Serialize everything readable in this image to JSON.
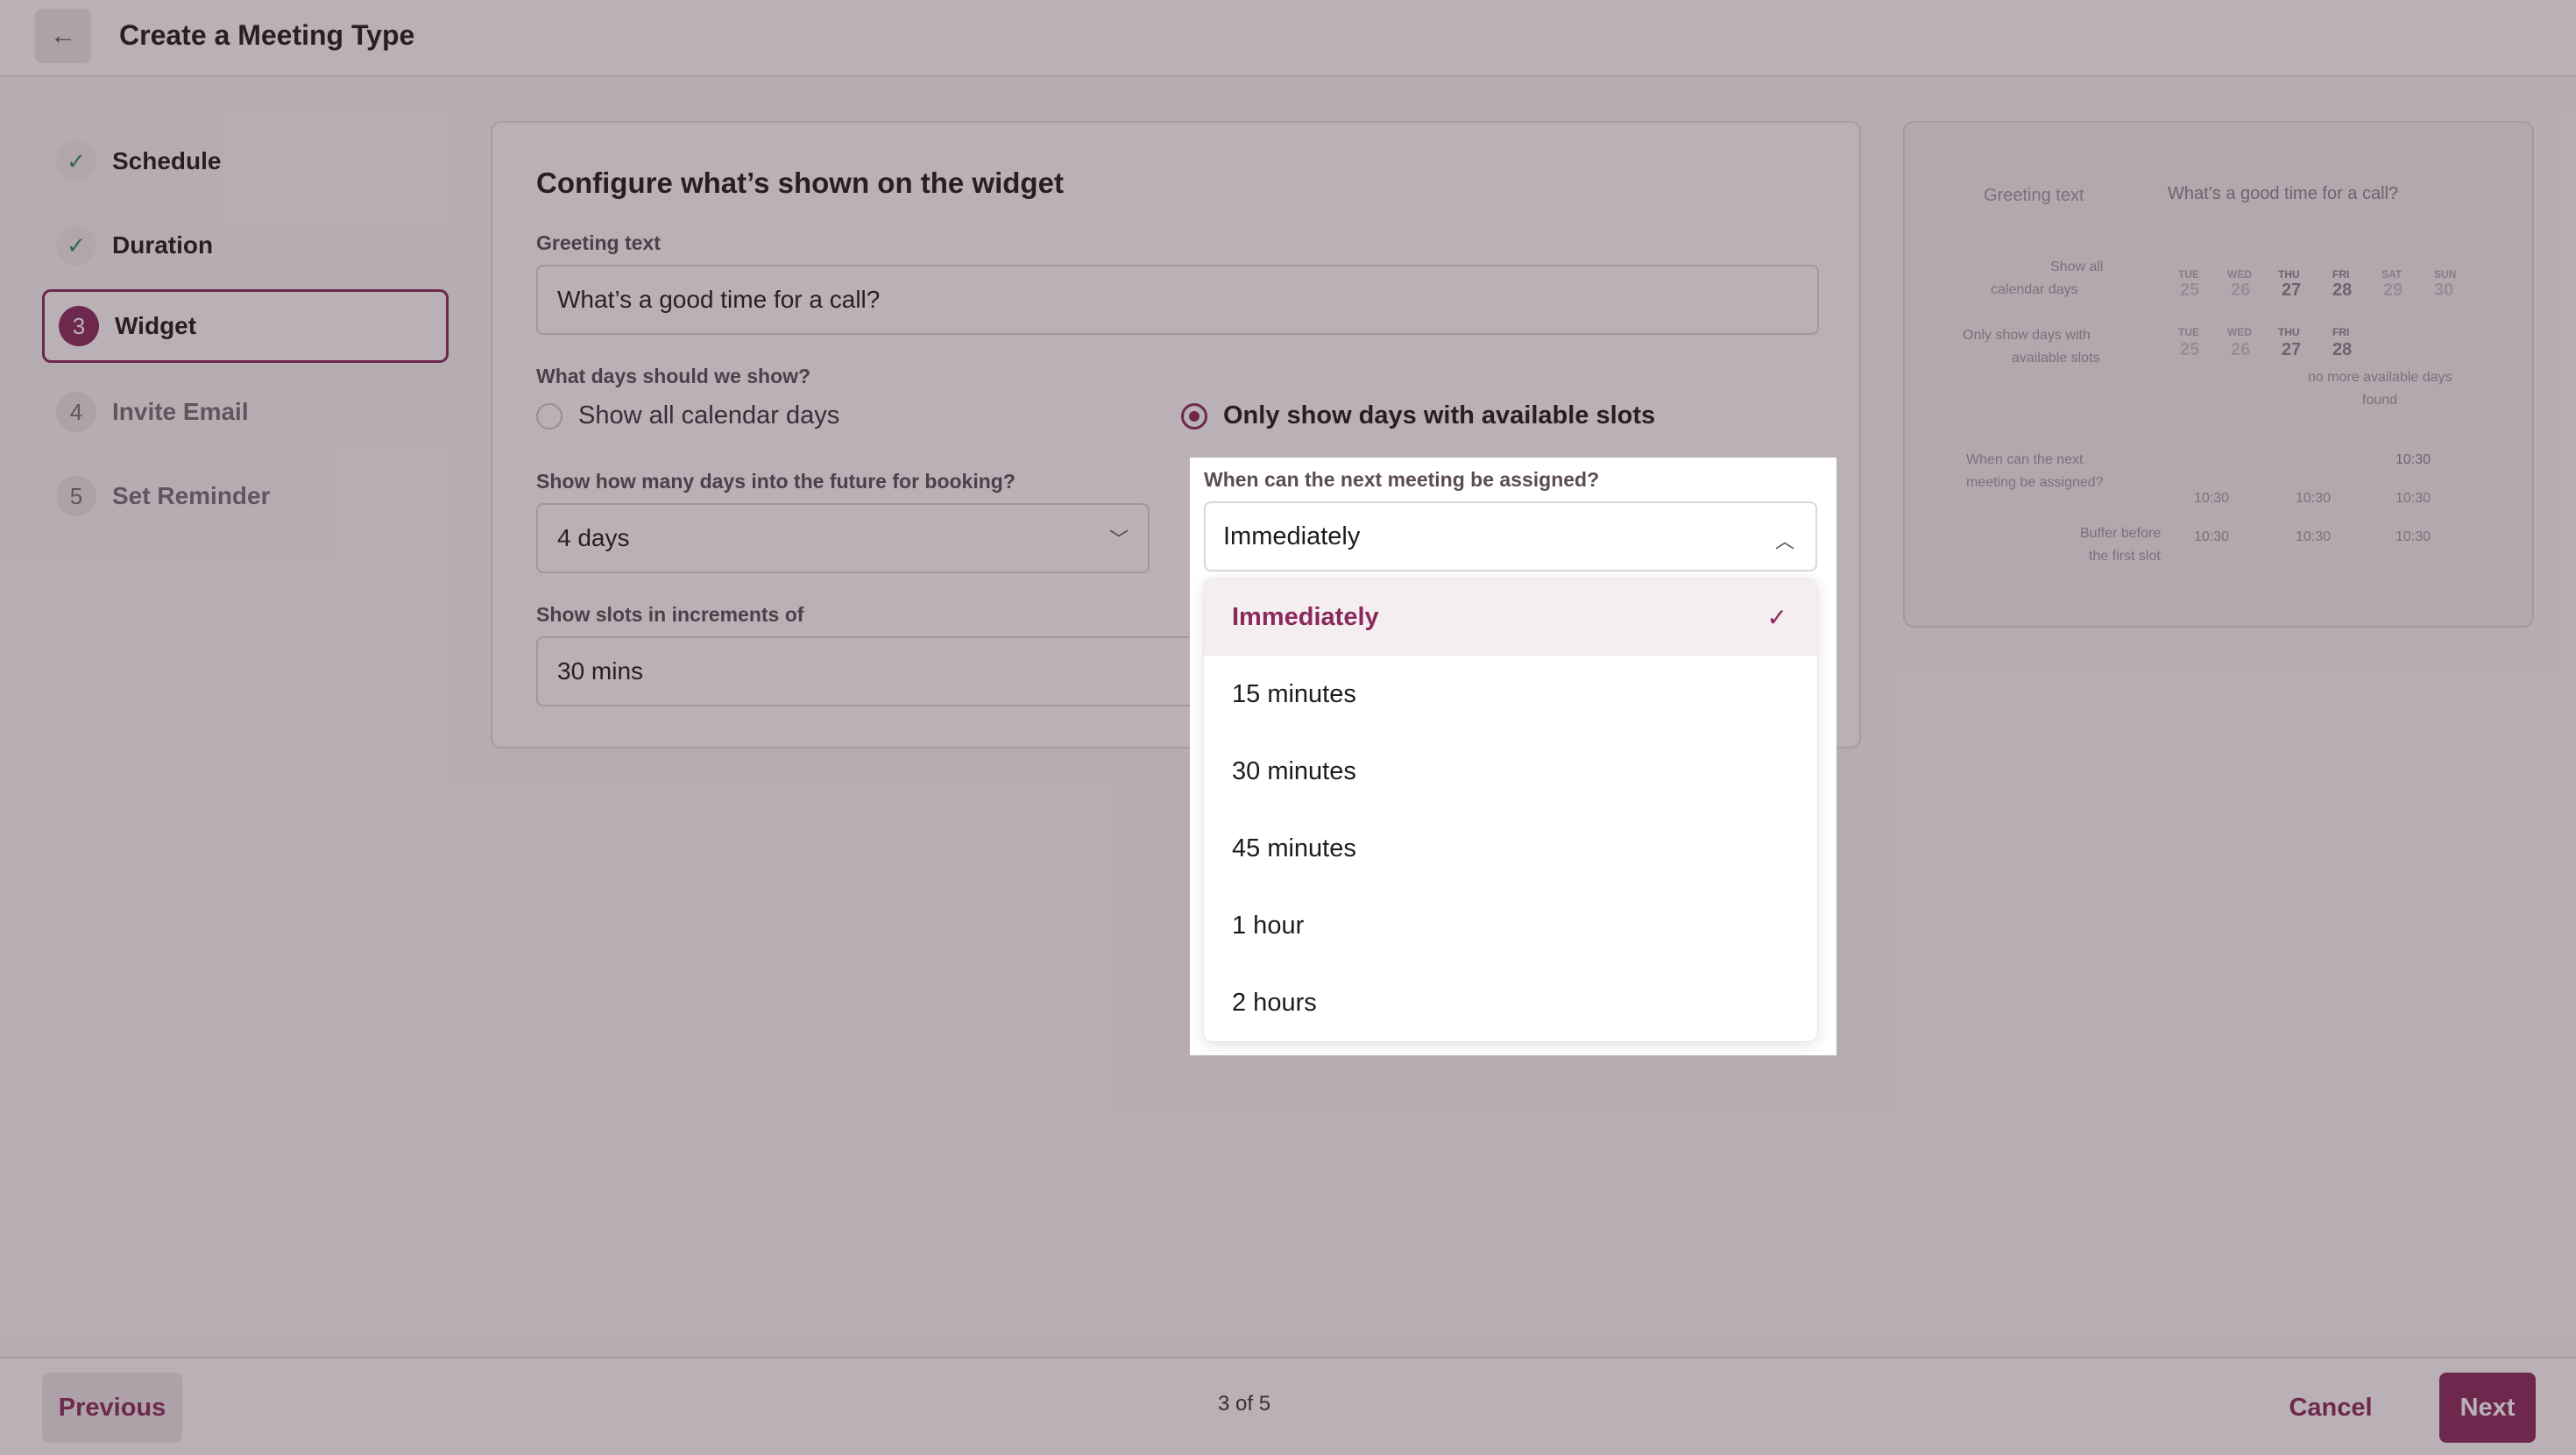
{
  "header": {
    "title": "Create a Meeting Type",
    "back_icon": "arrow-left-icon"
  },
  "steps": [
    {
      "label": "Schedule",
      "status": "done",
      "marker": "✓"
    },
    {
      "label": "Duration",
      "status": "done",
      "marker": "✓"
    },
    {
      "label": "Widget",
      "status": "active",
      "marker": "3"
    },
    {
      "label": "Invite Email",
      "status": "todo",
      "marker": "4"
    },
    {
      "label": "Set Reminder",
      "status": "todo",
      "marker": "5"
    }
  ],
  "card": {
    "title": "Configure what’s shown on the widget",
    "greeting_label": "Greeting text",
    "greeting_value": "What’s a good time for a call?",
    "days_question": "What days should we show?",
    "radio_all": "Show all calendar days",
    "radio_available": "Only show days with available slots",
    "future_label": "Show how many days into the future for booking?",
    "future_value": "4 days",
    "increment_label": "Show slots in increments of",
    "increment_value": "30 mins"
  },
  "dropdown": {
    "label": "When can the next meeting be assigned?",
    "value": "Immediately",
    "options": [
      "Immediately",
      "15 minutes",
      "30 minutes",
      "45 minutes",
      "1 hour",
      "2 hours"
    ],
    "selected_check": "✓"
  },
  "preview": {
    "greeting_label": "Greeting text",
    "greeting_value": "What’s a good time for a call?",
    "row1_label_a": "Show all",
    "row1_label_b": "calendar days",
    "row2_label_a": "Only show days with",
    "row2_label_b": "available slots",
    "days": [
      "TUE",
      "WED",
      "THU",
      "FRI",
      "SAT",
      "SUN"
    ],
    "dates": [
      "25",
      "26",
      "27",
      "28",
      "29",
      "30"
    ],
    "days2": [
      "TUE",
      "WED",
      "THU",
      "FRI"
    ],
    "dates2": [
      "25",
      "26",
      "27",
      "28"
    ],
    "no_more_a": "no more available days",
    "no_more_b": "found",
    "next_label_a": "When can the next",
    "next_label_b": "meeting be assigned?",
    "buffer_a": "Buffer before",
    "buffer_b": "the first slot",
    "slot": "10:30"
  },
  "footer": {
    "previous": "Previous",
    "pager": "3 of 5",
    "cancel": "Cancel",
    "next": "Next"
  },
  "colors": {
    "brand": "#8a2a5c",
    "success": "#2f8f58"
  }
}
